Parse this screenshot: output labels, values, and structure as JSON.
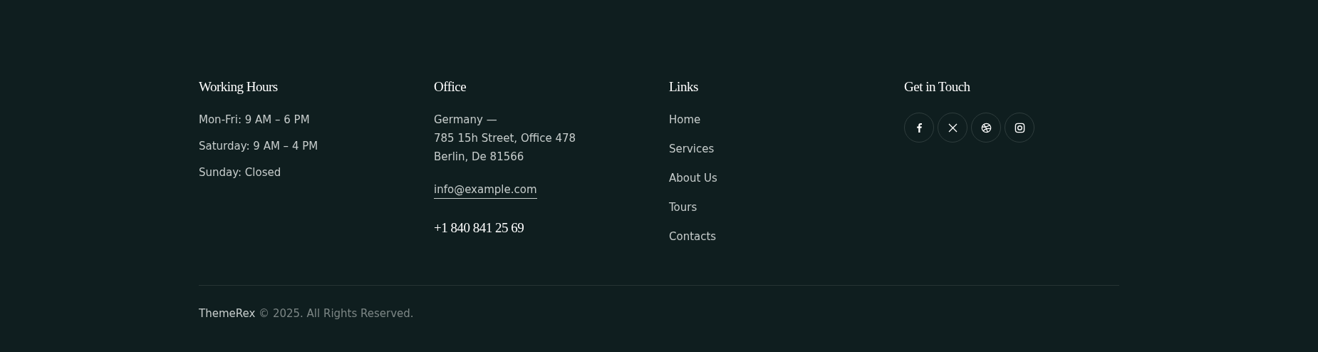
{
  "columns": [
    {
      "title": "Working Hours",
      "lines": [
        "Mon-Fri: 9 AM – 6 PM",
        "Saturday: 9 AM – 4 PM",
        "Sunday: Closed"
      ]
    },
    {
      "title": "Office",
      "address": [
        "Germany —",
        "785 15h Street, Office 478",
        "Berlin, De 81566"
      ],
      "email": "info@example.com",
      "phone": "+1 840 841 25 69"
    },
    {
      "title": "Links",
      "links": [
        "Home",
        "Services",
        "About Us",
        "Tours",
        "Contacts"
      ]
    },
    {
      "title": "Get in Touch",
      "socials": [
        {
          "kind": "facebook"
        },
        {
          "kind": "x"
        },
        {
          "kind": "dribbble"
        },
        {
          "kind": "instagram"
        }
      ]
    }
  ],
  "copyright": {
    "brand": "ThemeRex",
    "text": "© 2025. All Rights Reserved."
  }
}
